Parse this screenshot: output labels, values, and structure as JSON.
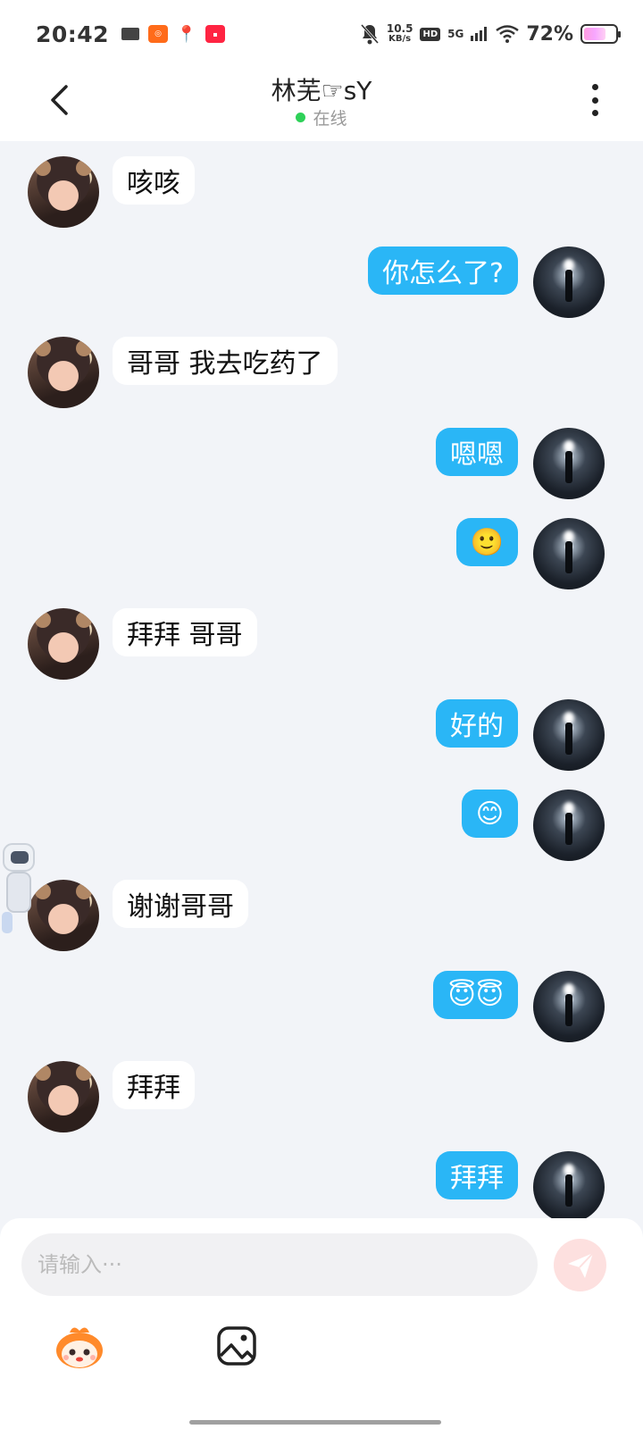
{
  "status_bar": {
    "time": "20:42",
    "speed_top": "10.5",
    "speed_bottom": "KB/s",
    "hd": "HD",
    "network": "5G",
    "battery_pct": "72%",
    "battery_level": 0.72
  },
  "header": {
    "title": "林芜☞sY",
    "status": "在线"
  },
  "messages": [
    {
      "side": "in",
      "text": "咳咳"
    },
    {
      "side": "out",
      "text": "你怎么了?"
    },
    {
      "side": "in",
      "text": "哥哥 我去吃药了"
    },
    {
      "side": "out",
      "text": "嗯嗯"
    },
    {
      "side": "out",
      "text": "🙂"
    },
    {
      "side": "in",
      "text": "拜拜 哥哥"
    },
    {
      "side": "out",
      "text": "好的"
    },
    {
      "side": "out",
      "text": "😊"
    },
    {
      "side": "in",
      "text": "谢谢哥哥"
    },
    {
      "side": "out",
      "text": "😇😇"
    },
    {
      "side": "in",
      "text": "拜拜"
    },
    {
      "side": "out",
      "text": "拜拜"
    }
  ],
  "input": {
    "placeholder": "请输入···"
  },
  "colors": {
    "outgoing_bubble": "#2ab6f6",
    "incoming_bubble": "#ffffff",
    "background": "#f2f4f8",
    "online": "#2ed158",
    "send_button": "#fde0df"
  },
  "icons": {
    "back": "chevron-left-icon",
    "more": "more-vertical-icon",
    "send": "paper-plane-icon",
    "gallery": "image-icon",
    "mascot": "mascot-emoji-icon"
  }
}
